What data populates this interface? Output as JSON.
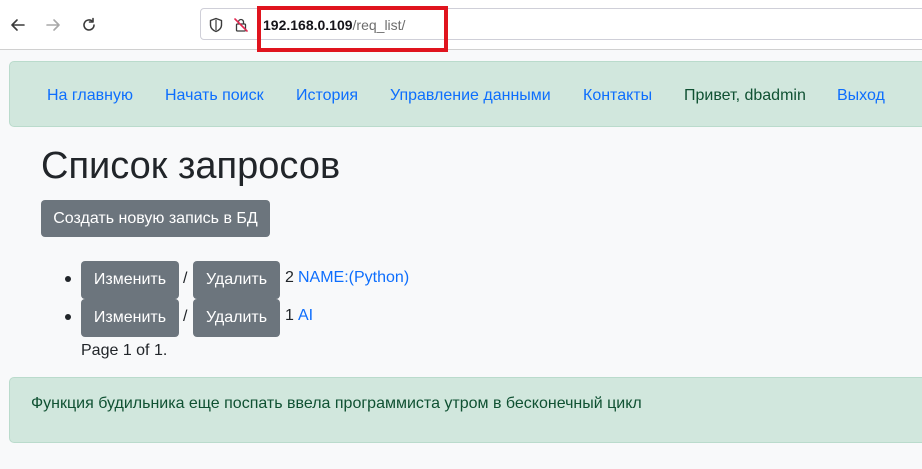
{
  "browser": {
    "url_host": "192.168.0.109",
    "url_path": "/req_list/"
  },
  "navbar": {
    "home": "На главную",
    "search": "Начать поиск",
    "history": "История",
    "data_mgmt": "Управление данными",
    "contacts": "Контакты",
    "greeting": "Привет, dbadmin",
    "logout": "Выход"
  },
  "main": {
    "title": "Список запросов",
    "create_button": "Создать новую запись в БД",
    "items": [
      {
        "edit_label": "Изменить",
        "separator": "/",
        "delete_label": "Удалить",
        "id": "2",
        "name": "NAME:(Python)"
      },
      {
        "edit_label": "Изменить",
        "separator": "/",
        "delete_label": "Удалить",
        "id": "1",
        "name": "AI"
      }
    ],
    "pagination": "Page 1 of 1."
  },
  "footer": {
    "message": "Функция будильника еще поспать ввела программиста утром в бесконечный цикл"
  }
}
